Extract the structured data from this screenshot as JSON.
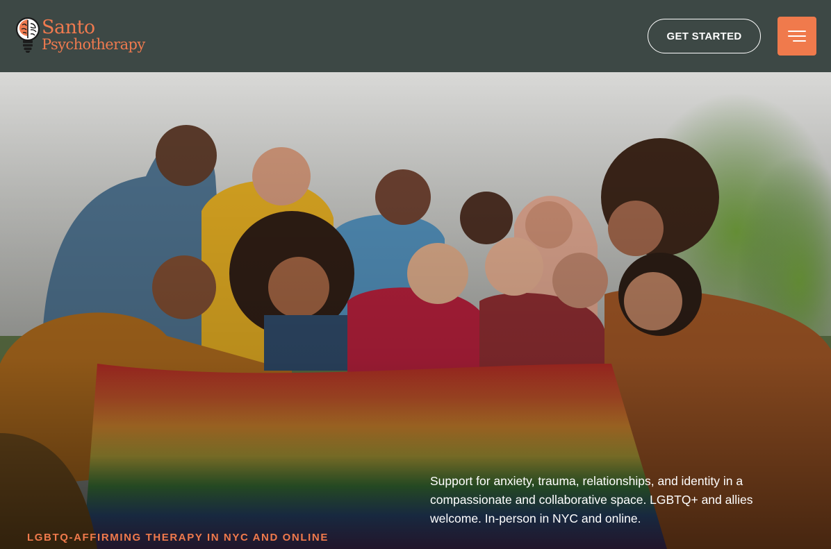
{
  "header": {
    "logo": {
      "line1": "Santo",
      "line2": "Psychotherapy",
      "icon": "lightbulb-brain-icon"
    },
    "cta_label": "GET STARTED",
    "menu_icon": "hamburger-menu-icon"
  },
  "hero": {
    "image_subject": "group-photo-with-rainbow-flag",
    "description": "Support for anxiety, trauma, relationships, and identity in a compassionate and collaborative space. LGBTQ+ and allies welcome. In-person in NYC and online.",
    "eyebrow": "LGBTQ-AFFIRMING THERAPY IN NYC AND ONLINE"
  },
  "colors": {
    "header_bg": "#3d4845",
    "accent": "#f07a4c",
    "text_light": "#ffffff"
  }
}
